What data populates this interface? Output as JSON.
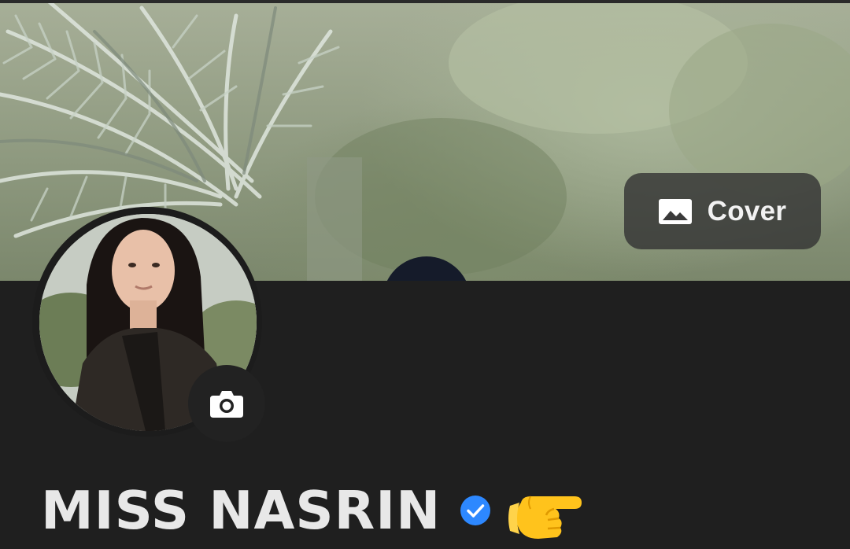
{
  "cover_photo": {
    "alt": "cover-photo",
    "button": {
      "label": "Cover",
      "icon": "image-icon"
    }
  },
  "profile": {
    "avatar_icon": "profile-photo",
    "camera_icon": "camera-icon",
    "name": "MISS NASRIN",
    "verified_icon": "verified-badge-icon",
    "emoji": "👉",
    "emoji_icon": "pointing-right-hand-icon"
  },
  "colors": {
    "background": "#1f1f1f",
    "name_text": "#e8e8e8",
    "verified_blue": "#2d88ff",
    "emoji_yellow": "#ffc31c"
  }
}
